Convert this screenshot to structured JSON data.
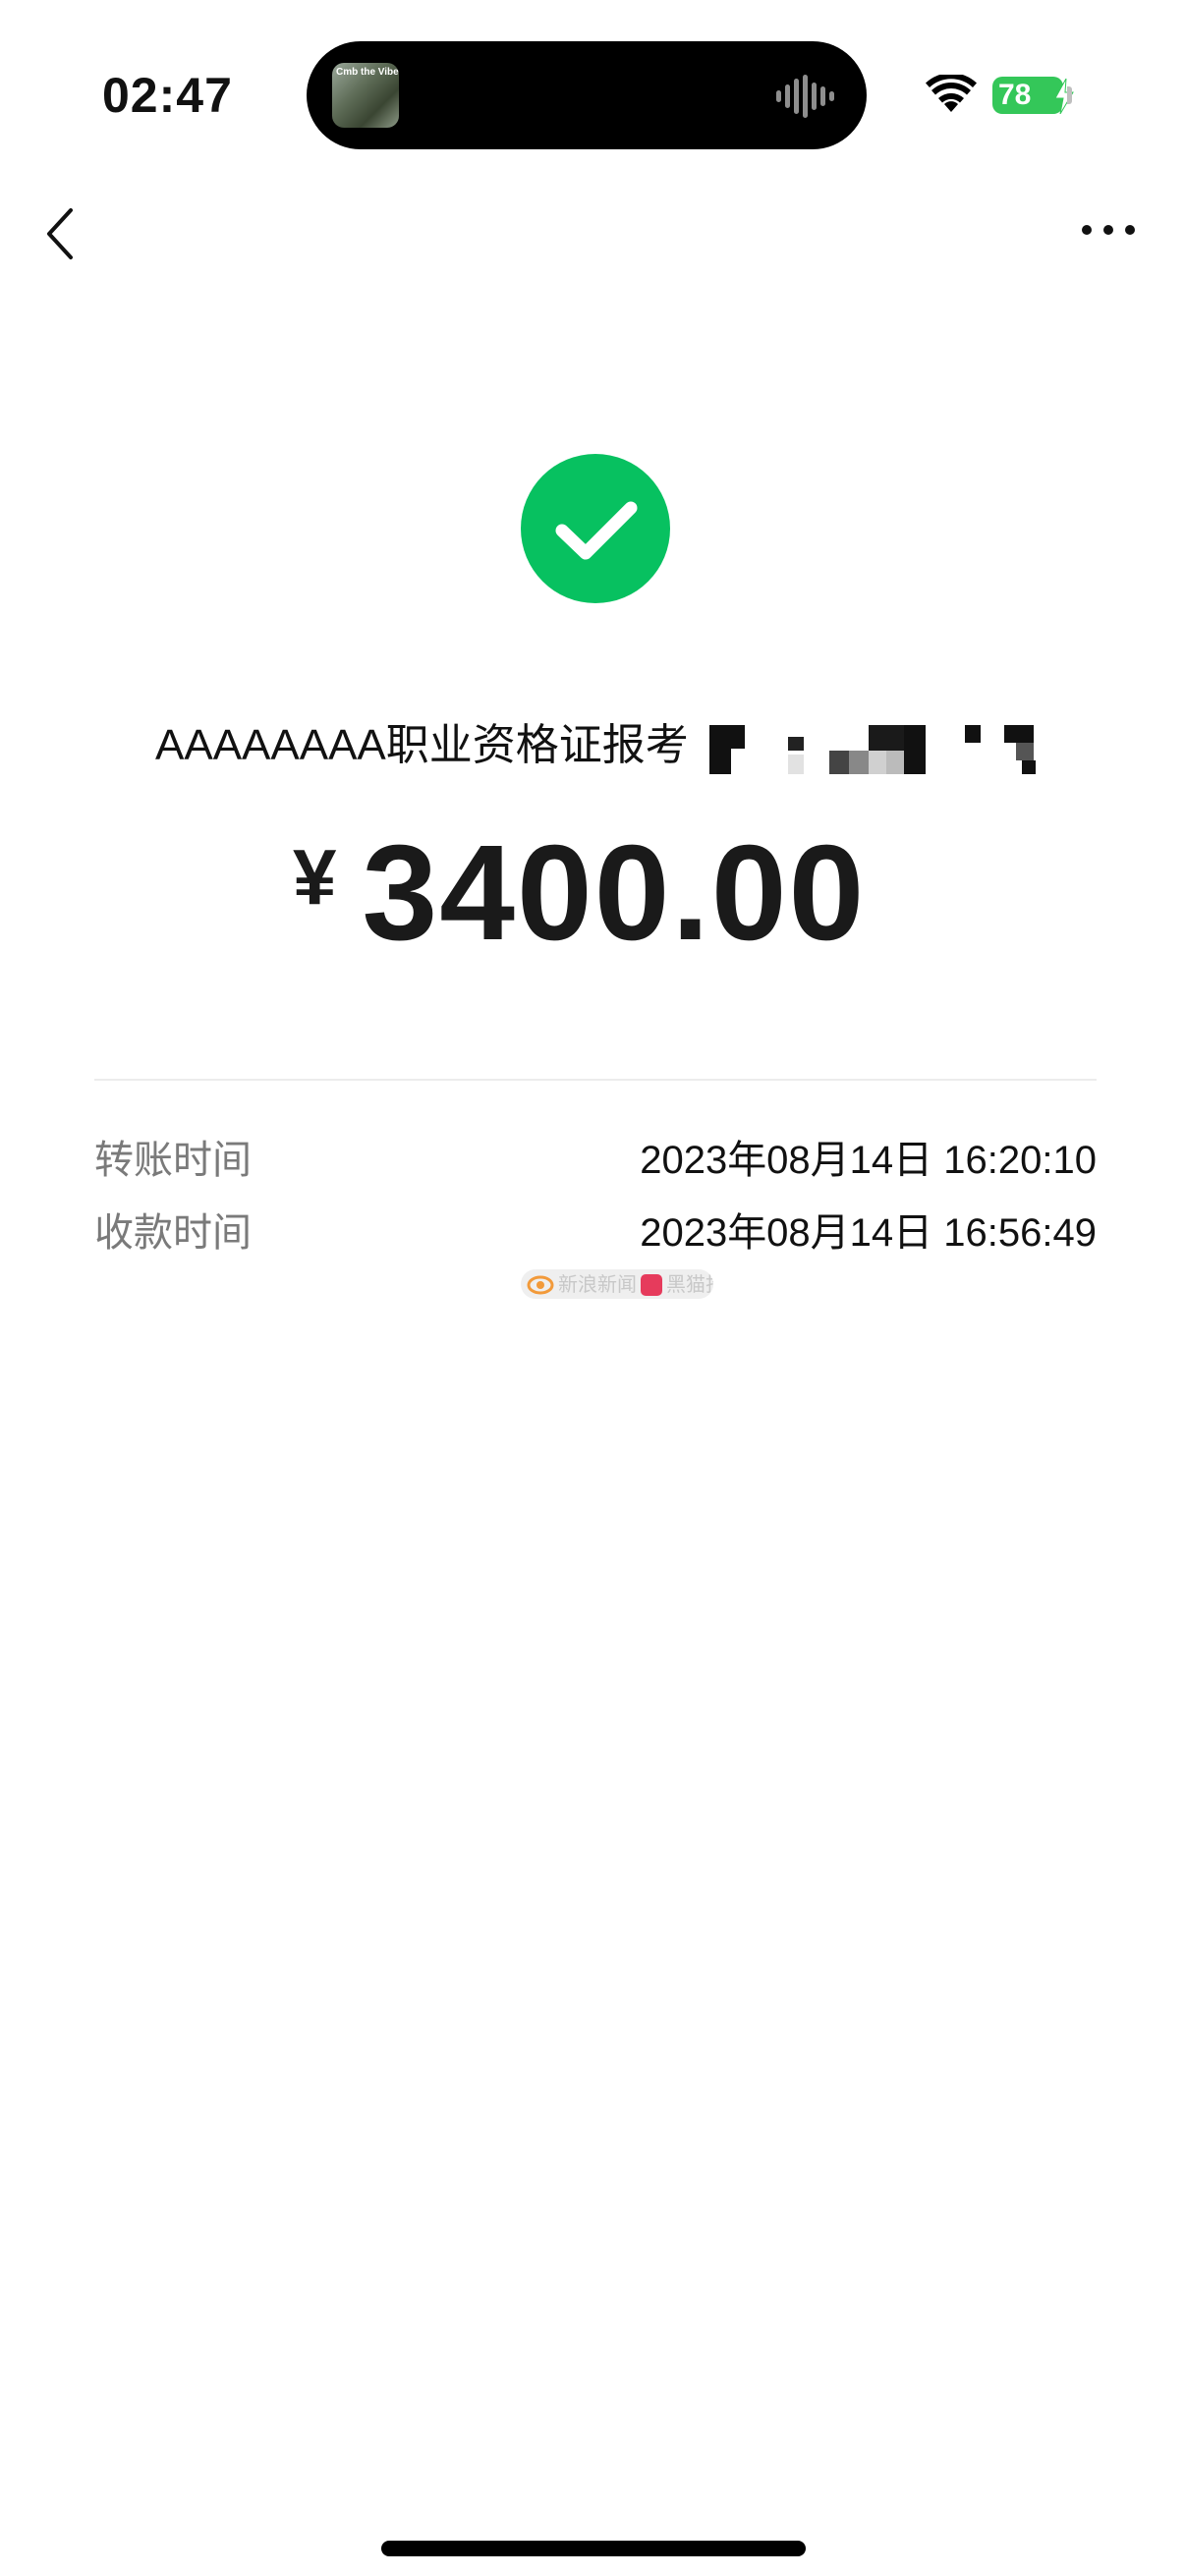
{
  "status_bar": {
    "time": "02:47",
    "battery": "78",
    "now_playing_art_text": "Cmb the Vibe"
  },
  "nav": {
    "back_icon": "chevron-left-icon",
    "more_icon": "ellipsis-icon"
  },
  "transfer": {
    "status_icon": "check-circle-icon",
    "payee": "AAAAAAAA职业资格证报考",
    "currency_symbol": "¥",
    "amount": "3400.00"
  },
  "details": [
    {
      "label": "转账时间",
      "value": "2023年08月14日 16:20:10"
    },
    {
      "label": "收款时间",
      "value": "2023年08月14日 16:56:49"
    }
  ],
  "watermark": {
    "text_left": "新浪新闻",
    "text_right": "黑猫投诉"
  },
  "colors": {
    "success_green": "#07c160",
    "battery_green": "#34c759",
    "label_gray": "#7a7a7a"
  }
}
